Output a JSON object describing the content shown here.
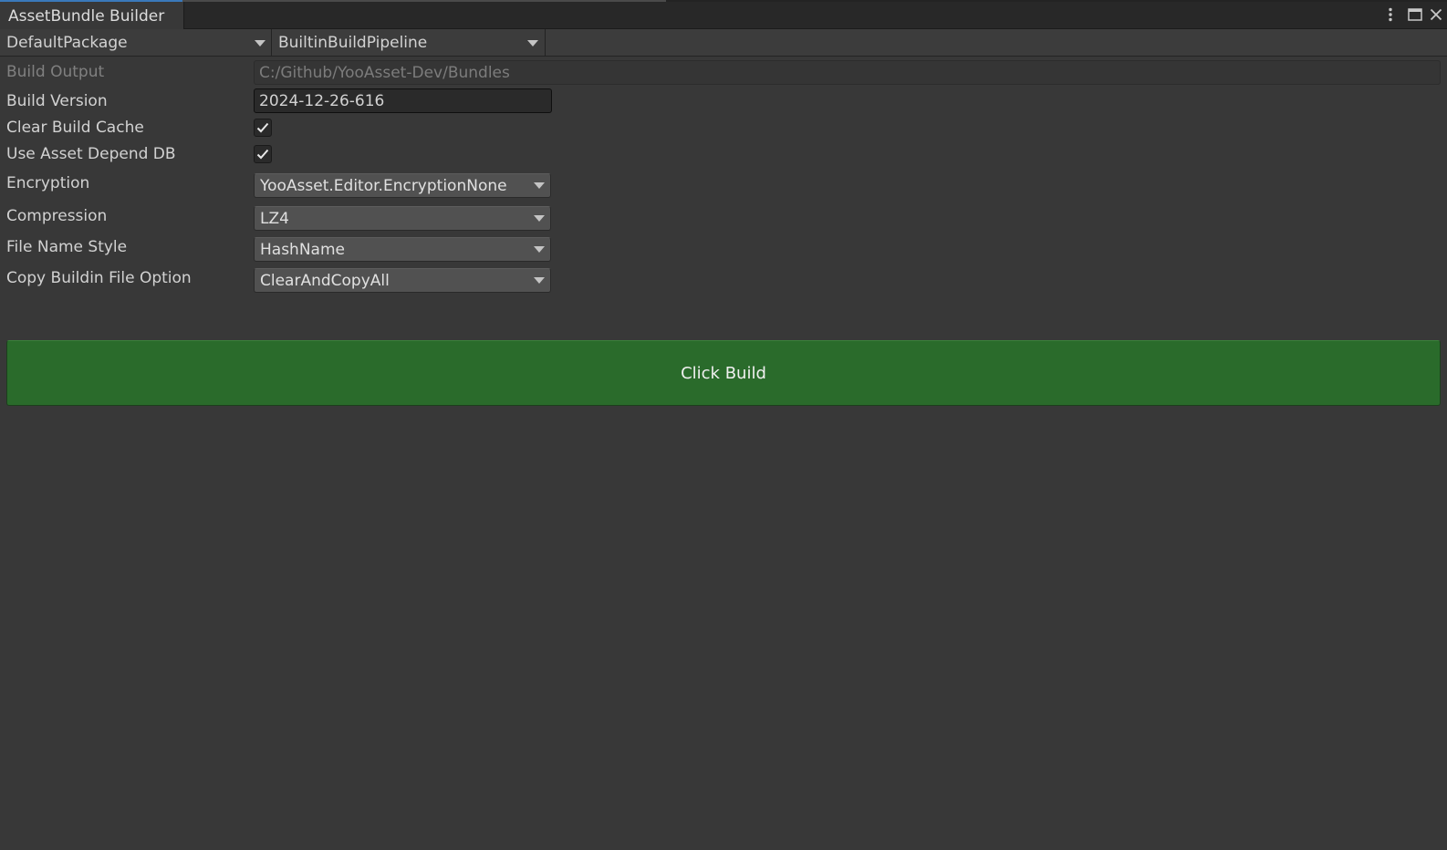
{
  "window": {
    "tab_title": "AssetBundle Builder",
    "menu_icon": "vertical-ellipsis-icon",
    "maximize_icon": "maximize-icon",
    "close_icon": "close-icon"
  },
  "toolbar": {
    "package_selected": "DefaultPackage",
    "pipeline_selected": "BuiltinBuildPipeline"
  },
  "form": {
    "build_output": {
      "label": "Build Output",
      "value": "C:/Github/YooAsset-Dev/Bundles",
      "enabled": false
    },
    "build_version": {
      "label": "Build Version",
      "value": "2024-12-26-616"
    },
    "clear_build_cache": {
      "label": "Clear Build Cache",
      "checked": true
    },
    "use_asset_depend_db": {
      "label": "Use Asset Depend DB",
      "checked": true
    },
    "encryption": {
      "label": "Encryption",
      "selected": "YooAsset.Editor.EncryptionNone"
    },
    "compression": {
      "label": "Compression",
      "selected": "LZ4"
    },
    "file_name_style": {
      "label": "File Name Style",
      "selected": "HashName"
    },
    "copy_buildin_file_option": {
      "label": "Copy Buildin File Option",
      "selected": "ClearAndCopyAll"
    }
  },
  "build_button": {
    "label": "Click Build",
    "color": "#2a6b2b"
  },
  "theme": {
    "background": "#383838",
    "accent": "#3a79bb"
  }
}
